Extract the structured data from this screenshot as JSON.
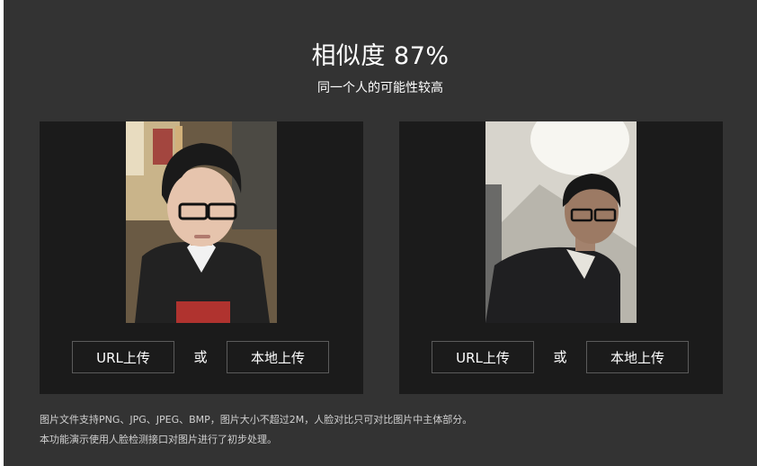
{
  "result": {
    "title": "相似度 87%",
    "subtitle": "同一个人的可能性较高"
  },
  "panels": [
    {
      "url_button": "URL上传",
      "or_label": "或",
      "local_button": "本地上传"
    },
    {
      "url_button": "URL上传",
      "or_label": "或",
      "local_button": "本地上传"
    }
  ],
  "notes": [
    "图片文件支持PNG、JPG、JPEG、BMP，图片大小不超过2M，人脸对比只可对比图片中主体部分。",
    "本功能演示使用人脸检测接口对图片进行了初步处理。"
  ]
}
